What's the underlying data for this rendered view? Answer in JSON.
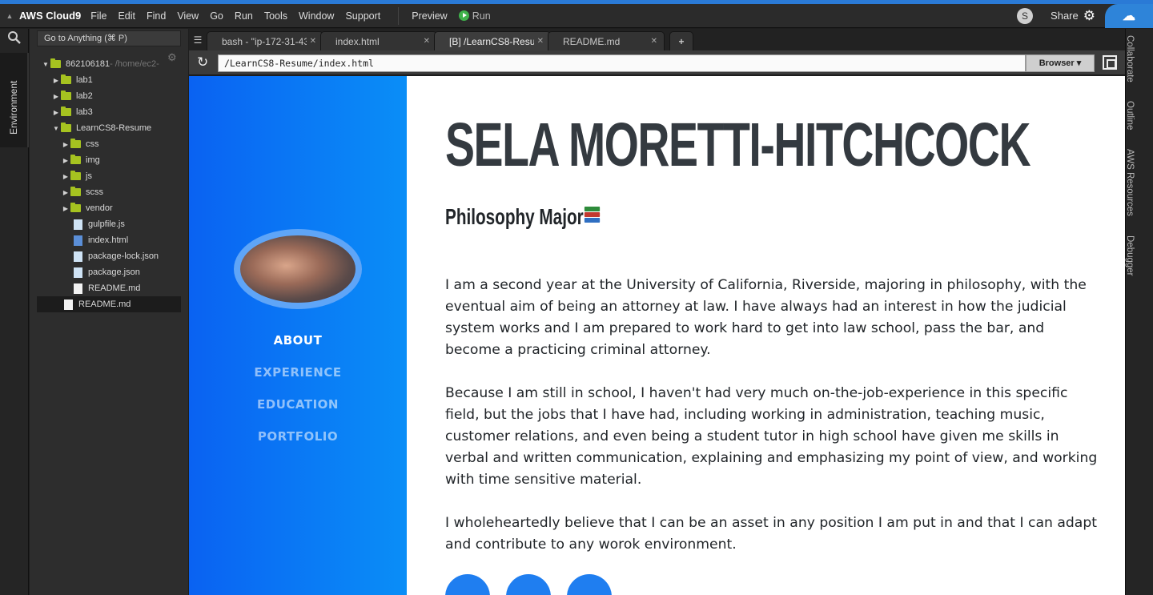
{
  "menubar": {
    "brand": "AWS Cloud9",
    "items": [
      "File",
      "Edit",
      "Find",
      "View",
      "Go",
      "Run",
      "Tools",
      "Window",
      "Support"
    ],
    "preview": "Preview",
    "run": "Run",
    "avatar": "S",
    "share": "Share"
  },
  "sidebar": {
    "goto": "Go to Anything (⌘ P)",
    "env_tab": "Environment",
    "root_label": "862106181",
    "root_path": " - /home/ec2-",
    "tree": [
      {
        "label": "lab1"
      },
      {
        "label": "lab2"
      },
      {
        "label": "lab3"
      },
      {
        "label": "LearnCS8-Resume"
      },
      {
        "label": "css"
      },
      {
        "label": "img"
      },
      {
        "label": "js"
      },
      {
        "label": "scss"
      },
      {
        "label": "vendor"
      },
      {
        "label": "gulpfile.js"
      },
      {
        "label": "index.html"
      },
      {
        "label": "package-lock.json"
      },
      {
        "label": "package.json"
      },
      {
        "label": "README.md"
      },
      {
        "label": "README.md"
      }
    ]
  },
  "right_rail": [
    "Collaborate",
    "Outline",
    "AWS Resources",
    "Debugger"
  ],
  "tabs": [
    {
      "label": "bash - \"ip-172-31-43"
    },
    {
      "label": "index.html"
    },
    {
      "label": "[B] /LearnCS8-Resu"
    },
    {
      "label": "README.md"
    }
  ],
  "browser": {
    "url": "/LearnCS8-Resume/index.html",
    "mode": "Browser"
  },
  "page": {
    "nav": [
      "ABOUT",
      "EXPERIENCE",
      "EDUCATION",
      "PORTFOLIO"
    ],
    "name": "SELA MORETTI-HITCHCOCK",
    "subtitle": "Philosophy Major",
    "paragraphs": [
      "I am a second year at the University of California, Riverside, majoring in philosophy, with the eventual aim of being an attorney at law. I have always had an interest in how the judicial system works and I am prepared to work hard to get into law school, pass the bar, and become a practicing criminal attorney.",
      "Because I am still in school, I haven't had very much on-the-job-experience in this specific field, but the jobs that I have had, including working in administration, teaching music, customer relations, and even being a student tutor in high school have given me skills in verbal and written communication, explaining and emphasizing my point of view, and working with time sensitive material.",
      "I wholeheartedly believe that I can be an asset in any position I am put in and that I can adapt and contribute to any worok environment."
    ]
  },
  "colors": {
    "sidebar_start": "#0a62f2",
    "sidebar_end": "#0a8ef7",
    "run_green": "#3fb24b",
    "folder": "#a6c320"
  }
}
